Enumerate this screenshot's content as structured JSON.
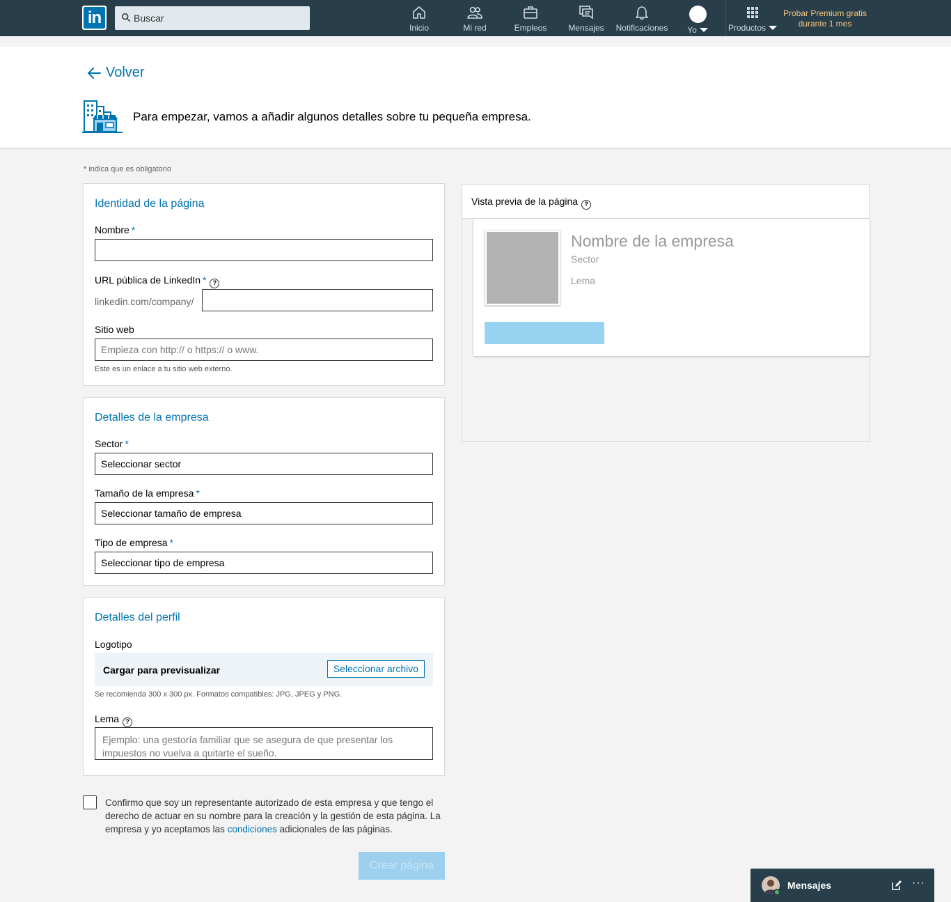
{
  "nav": {
    "logo_text": "in",
    "search_placeholder": "Buscar",
    "items": [
      {
        "label": "Inicio",
        "icon": "home-icon"
      },
      {
        "label": "Mi red",
        "icon": "network-icon"
      },
      {
        "label": "Empleos",
        "icon": "briefcase-icon"
      },
      {
        "label": "Mensajes",
        "icon": "messages-icon"
      },
      {
        "label": "Notificaciones",
        "icon": "bell-icon"
      },
      {
        "label": "Yo",
        "icon": "avatar"
      },
      {
        "label": "Productos",
        "icon": "grid-icon"
      }
    ],
    "premium_line1": "Probar Premium gratis",
    "premium_line2": "durante 1 mes"
  },
  "header": {
    "back_label": "Volver",
    "intro": "Para empezar, vamos a añadir algunos detalles sobre tu pequeña empresa."
  },
  "form": {
    "required_note": "* indica que es obligatorio",
    "identity": {
      "title": "Identidad de la página",
      "name_label": "Nombre",
      "name_value": "",
      "url_label": "URL pública de LinkedIn",
      "url_prefix": "linkedin.com/company/",
      "url_value": "",
      "website_label": "Sitio web",
      "website_placeholder": "Empieza con http:// o https:// o www.",
      "website_hint": "Este es un enlace a tu sitio web externo."
    },
    "company": {
      "title": "Detalles de la empresa",
      "sector_label": "Sector",
      "sector_value": "Seleccionar sector",
      "size_label": "Tamaño de la empresa",
      "size_value": "Seleccionar tamaño de empresa",
      "type_label": "Tipo de empresa",
      "type_value": "Seleccionar tipo de empresa"
    },
    "profile": {
      "title": "Detalles del perfil",
      "logo_label": "Logotipo",
      "upload_label": "Cargar para previsualizar",
      "upload_button": "Seleccionar archivo",
      "logo_hint": "Se recomienda 300 x 300 px. Formatos compatibles: JPG, JPEG y PNG.",
      "tagline_label": "Lema",
      "tagline_placeholder": "Ejemplo: una gestoría familiar que se asegura de que presentar los impuestos no vuelva a quitarte el sueño."
    },
    "required_mark": "*",
    "help_mark": "?",
    "confirm_part1": "Confirmo que soy un representante autorizado de esta empresa y que tengo el derecho de actuar en su nombre para la creación y la gestión de esta página. La empresa y yo aceptamos las ",
    "confirm_link": "condiciones",
    "confirm_part2": " adicionales de las páginas.",
    "confirm_checked": false,
    "create_button": "Crear página"
  },
  "preview": {
    "title": "Vista previa de la página",
    "company_name": "Nombre de la empresa",
    "sector": "Sector",
    "tagline": "Lema"
  },
  "messaging": {
    "label": "Mensajes",
    "more": "···"
  },
  "colors": {
    "nav_bg": "#283e4a",
    "accent": "#0073b1",
    "premium": "#f5c77f",
    "disabled_button": "#9dd0ef"
  }
}
